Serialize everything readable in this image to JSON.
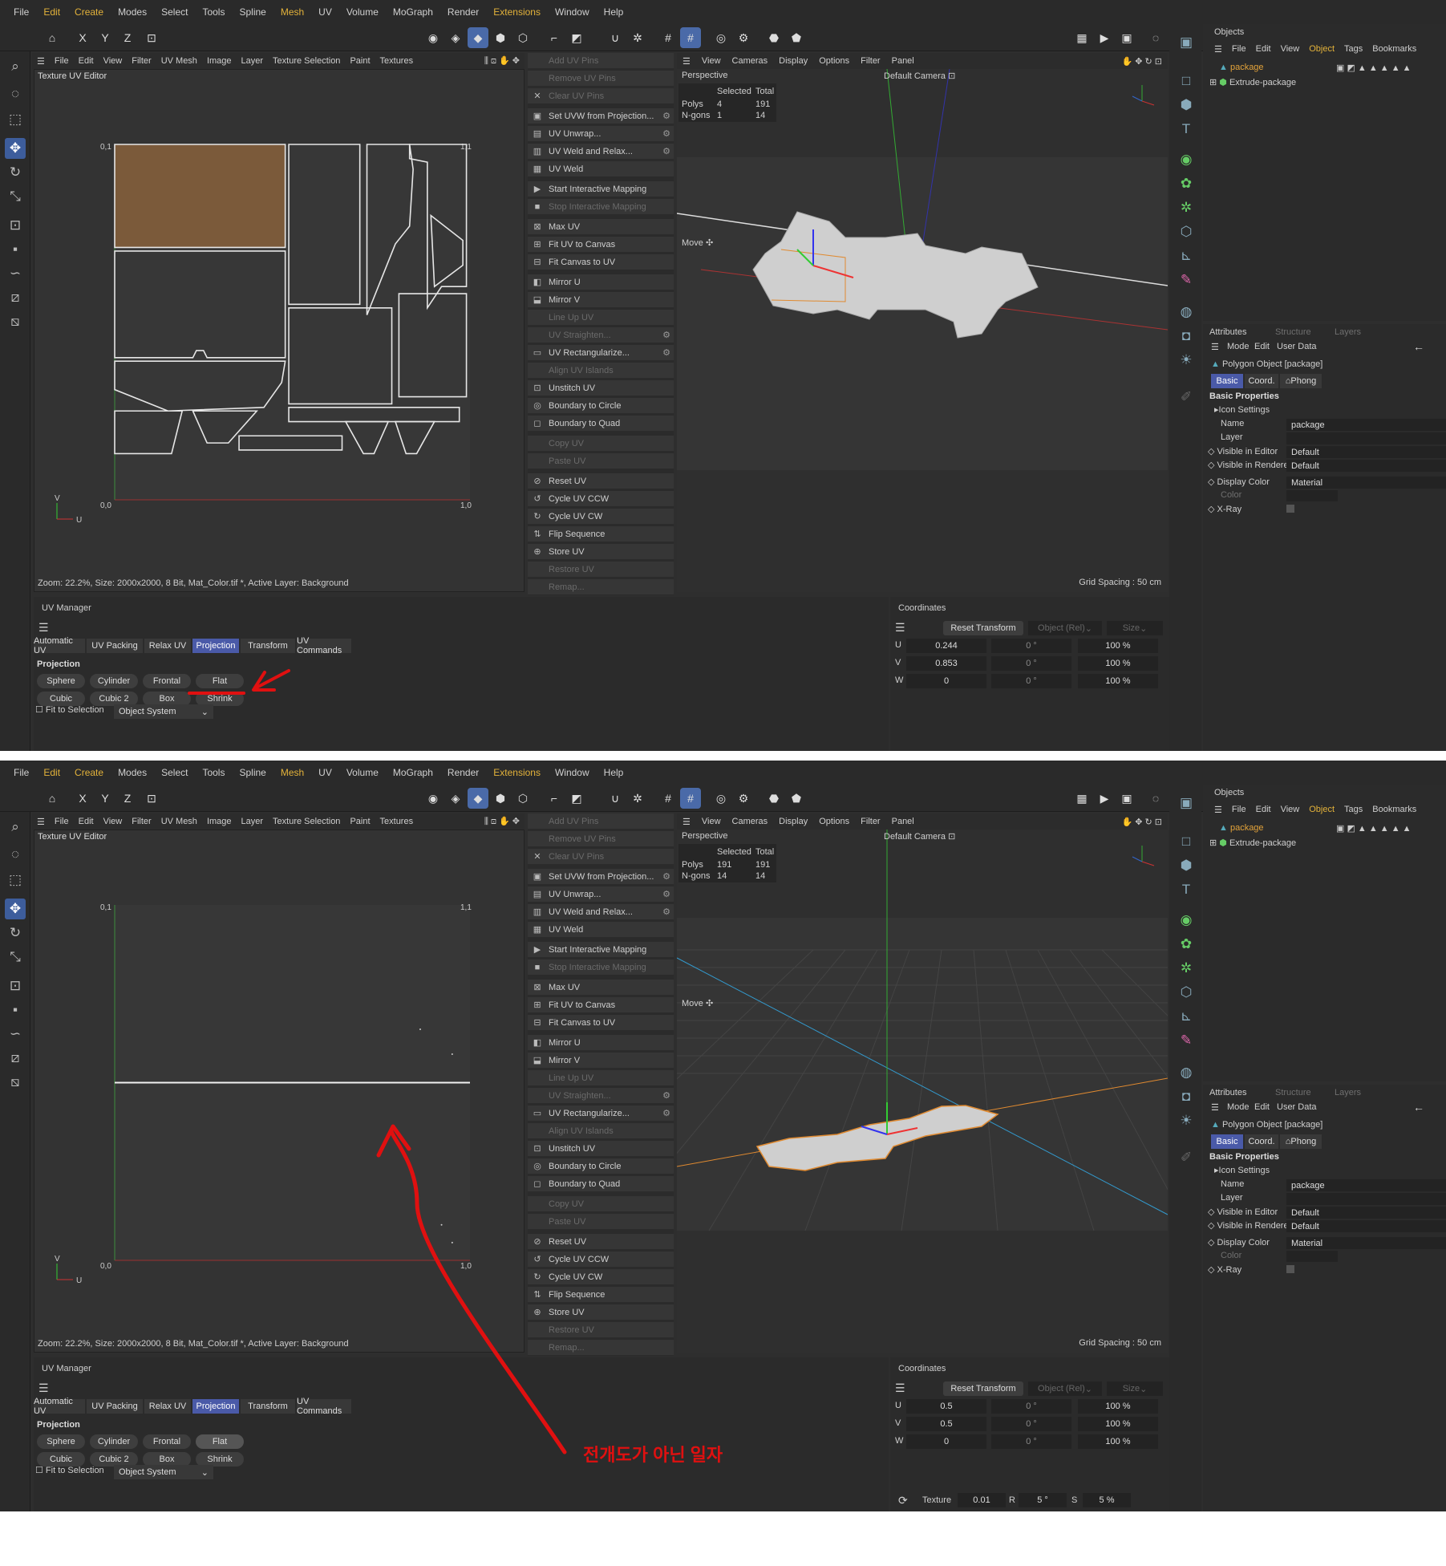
{
  "menubar": [
    "File",
    "Edit",
    "Create",
    "Modes",
    "Select",
    "Tools",
    "Spline",
    "Mesh",
    "UV",
    "Volume",
    "MoGraph",
    "Render",
    "Extensions",
    "Window",
    "Help"
  ],
  "uv_menu": [
    "File",
    "Edit",
    "View",
    "Filter",
    "UV Mesh",
    "Image",
    "Layer",
    "Texture Selection",
    "Paint",
    "Textures"
  ],
  "uv_editor_title": "Texture UV Editor",
  "uv_axis": {
    "u": "U",
    "v": "V",
    "tl": "0,1",
    "tr": "1,1",
    "bl": "0,0",
    "br": "1,0"
  },
  "uv_status": "Zoom: 22.2%, Size: 2000x2000, 8 Bit, Mat_Color.tif *, Active Layer: Background",
  "uv_commands": [
    {
      "label": "Add UV Pins",
      "disabled": true,
      "gear": false,
      "icon": ""
    },
    {
      "label": "Remove UV Pins",
      "disabled": true,
      "gear": false,
      "icon": ""
    },
    {
      "label": "Clear UV Pins",
      "disabled": true,
      "gear": false,
      "icon": "✕"
    },
    {
      "label": "Set UVW from Projection...",
      "disabled": false,
      "gear": true,
      "icon": "▣"
    },
    {
      "label": "UV Unwrap...",
      "disabled": false,
      "gear": true,
      "icon": "▤"
    },
    {
      "label": "UV Weld and Relax...",
      "disabled": false,
      "gear": true,
      "icon": "▥"
    },
    {
      "label": "UV Weld",
      "disabled": false,
      "gear": false,
      "icon": "▦"
    },
    {
      "label": "Start Interactive Mapping",
      "disabled": false,
      "gear": false,
      "icon": "▶"
    },
    {
      "label": "Stop Interactive Mapping",
      "disabled": true,
      "gear": false,
      "icon": "■"
    },
    {
      "label": "Max UV",
      "disabled": false,
      "gear": false,
      "icon": "⊠"
    },
    {
      "label": "Fit UV to Canvas",
      "disabled": false,
      "gear": false,
      "icon": "⊞"
    },
    {
      "label": "Fit Canvas to UV",
      "disabled": false,
      "gear": false,
      "icon": "⊟"
    },
    {
      "label": "Mirror U",
      "disabled": false,
      "gear": false,
      "icon": "◧"
    },
    {
      "label": "Mirror V",
      "disabled": false,
      "gear": false,
      "icon": "⬓"
    },
    {
      "label": "Line Up UV",
      "disabled": true,
      "gear": false,
      "icon": ""
    },
    {
      "label": "UV Straighten...",
      "disabled": true,
      "gear": true,
      "icon": ""
    },
    {
      "label": "UV Rectangularize...",
      "disabled": false,
      "gear": true,
      "icon": "▭"
    },
    {
      "label": "Align UV Islands",
      "disabled": true,
      "gear": false,
      "icon": ""
    },
    {
      "label": "Unstitch UV",
      "disabled": false,
      "gear": false,
      "icon": "⊡"
    },
    {
      "label": "Boundary to Circle",
      "disabled": false,
      "gear": false,
      "icon": "◎"
    },
    {
      "label": "Boundary to Quad",
      "disabled": false,
      "gear": false,
      "icon": "◻"
    },
    {
      "label": "Copy UV",
      "disabled": true,
      "gear": false,
      "icon": ""
    },
    {
      "label": "Paste UV",
      "disabled": true,
      "gear": false,
      "icon": ""
    },
    {
      "label": "Reset UV",
      "disabled": false,
      "gear": false,
      "icon": "⊘"
    },
    {
      "label": "Cycle UV CCW",
      "disabled": false,
      "gear": false,
      "icon": "↺"
    },
    {
      "label": "Cycle UV CW",
      "disabled": false,
      "gear": false,
      "icon": "↻"
    },
    {
      "label": "Flip Sequence",
      "disabled": false,
      "gear": false,
      "icon": "⇅"
    },
    {
      "label": "Store UV",
      "disabled": false,
      "gear": false,
      "icon": "⊕"
    },
    {
      "label": "Restore UV",
      "disabled": true,
      "gear": false,
      "icon": ""
    },
    {
      "label": "Remap...",
      "disabled": true,
      "gear": false,
      "icon": ""
    }
  ],
  "viewport_menu": [
    "View",
    "Cameras",
    "Display",
    "Options",
    "Filter",
    "Panel"
  ],
  "viewport": {
    "label": "Perspective",
    "camera": "Default Camera",
    "move": "Move",
    "grid": "Grid Spacing : 50 cm",
    "stats_head": [
      "Selected",
      "Total"
    ],
    "stats_rows": [
      "Polys",
      "N-gons"
    ]
  },
  "shots": [
    {
      "polys_sel": "4",
      "polys_total": "191",
      "ngons_sel": "1",
      "ngons_total": "14",
      "coord_u": "0.244",
      "coord_v": "0.853",
      "coord_w": "0"
    },
    {
      "polys_sel": "191",
      "polys_total": "191",
      "ngons_sel": "14",
      "ngons_total": "14",
      "coord_u": "0.5",
      "coord_v": "0.5",
      "coord_w": "0"
    }
  ],
  "objects": {
    "title": "Objects",
    "menu": [
      "File",
      "Edit",
      "View",
      "Object",
      "Tags",
      "Bookmarks"
    ],
    "items": [
      "package",
      "Extrude-package"
    ]
  },
  "attributes": {
    "tabs": [
      "Attributes",
      "Structure",
      "Layers"
    ],
    "menu": [
      "Mode",
      "Edit",
      "User Data"
    ],
    "object": "Polygon Object [package]",
    "subtabs": [
      "Basic",
      "Coord.",
      "Phong"
    ],
    "section": "Basic Properties",
    "icon_settings": "Icon Settings",
    "rows": [
      {
        "label": "Name",
        "value": "package"
      },
      {
        "label": "Layer",
        "value": ""
      },
      {
        "label": "Visible in Editor",
        "value": "Default"
      },
      {
        "label": "Visible in Renderer",
        "value": "Default"
      },
      {
        "label": "Display Color",
        "value": "Material"
      },
      {
        "label": "Color",
        "value": ""
      },
      {
        "label": "X-Ray",
        "value": ""
      }
    ]
  },
  "uv_manager": {
    "title": "UV Manager",
    "tabs": [
      "Automatic UV",
      "UV Packing",
      "Relax UV",
      "Projection",
      "Transform",
      "UV Commands"
    ],
    "section": "Projection",
    "buttons": [
      "Sphere",
      "Cylinder",
      "Frontal",
      "Flat",
      "Cubic",
      "Cubic 2",
      "Box",
      "Shrink"
    ],
    "fit": "Fit to Selection",
    "system": "Object System"
  },
  "coordinates": {
    "title": "Coordinates",
    "reset": "Reset Transform",
    "mode": "Object (Rel)",
    "size": "Size",
    "rows": [
      "U",
      "V",
      "W"
    ],
    "rot": "0 °",
    "scale": "100 %"
  },
  "texture_bar": {
    "label": "Texture",
    "val": "0.01",
    "r_label": "R",
    "r_val": "5 °",
    "s_label": "S",
    "s_val": "5 %"
  },
  "annotation_text": "전개도가 아닌 일자",
  "colors": {
    "bg": "#2e2e2e",
    "accent": "#4a5aa8",
    "island_fill": "#7b5a3a",
    "annotation": "#e01010",
    "selection": "#e08a30"
  }
}
